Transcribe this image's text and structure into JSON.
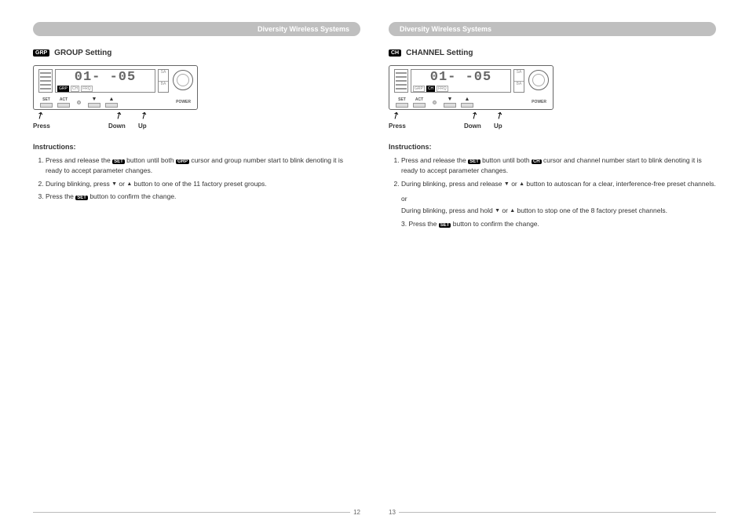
{
  "header": "Diversity Wireless Systems",
  "left": {
    "badge": "GRP",
    "title": "GROUP Setting",
    "display": "01- -05",
    "indicator_active": "GRP",
    "labels": {
      "press": "Press",
      "down": "Down",
      "up": "Up"
    },
    "instructions_title": "Instructions:",
    "steps": [
      {
        "pre": "Press and release the ",
        "badge": "SET",
        "mid": " button until both ",
        "badge2": "GRP",
        "post": " cursor and group number start to blink denoting it is ready to accept parameter changes."
      },
      {
        "pre": "During blinking, press ",
        "tri1": "▼",
        "mid": " or ",
        "tri2": "▲",
        "post": " button to one of the 11 factory preset groups."
      },
      {
        "pre": "Press the ",
        "badge": "SET",
        "post": " button to confirm the change."
      }
    ],
    "page_num": "12"
  },
  "right": {
    "badge": "CH",
    "title": "CHANNEL Setting",
    "display": "01- -05",
    "indicator_active": "CH",
    "labels": {
      "press": "Press",
      "down": "Down",
      "up": "Up"
    },
    "instructions_title": "Instructions:",
    "steps": [
      {
        "pre": "Press and release the ",
        "badge": "SET",
        "mid": " button until both ",
        "badge2": "CH",
        "post": " cursor and channel number start to blink denoting it is ready to accept parameter changes."
      },
      {
        "pre": "During blinking, press and release ",
        "tri1": "▼",
        "mid": " or ",
        "tri2": "▲",
        "post": " button to autoscan for a clear, interference-free preset channels."
      }
    ],
    "or": "or",
    "sub": {
      "pre": "During blinking, press and hold ",
      "tri1": "▼",
      "mid": " or ",
      "tri2": "▲",
      "post": " button to stop one of the 8 factory preset channels."
    },
    "step3": {
      "num": "3.",
      "pre": "Press the ",
      "badge": "SET",
      "post": " button to confirm the change."
    },
    "page_num": "13"
  },
  "btn_labels": {
    "set": "SET",
    "act": "ACT",
    "power": "POWER"
  },
  "indicators": [
    "GRP",
    "CH",
    "FRQ"
  ],
  "rboxes": [
    "SA",
    "BA"
  ]
}
